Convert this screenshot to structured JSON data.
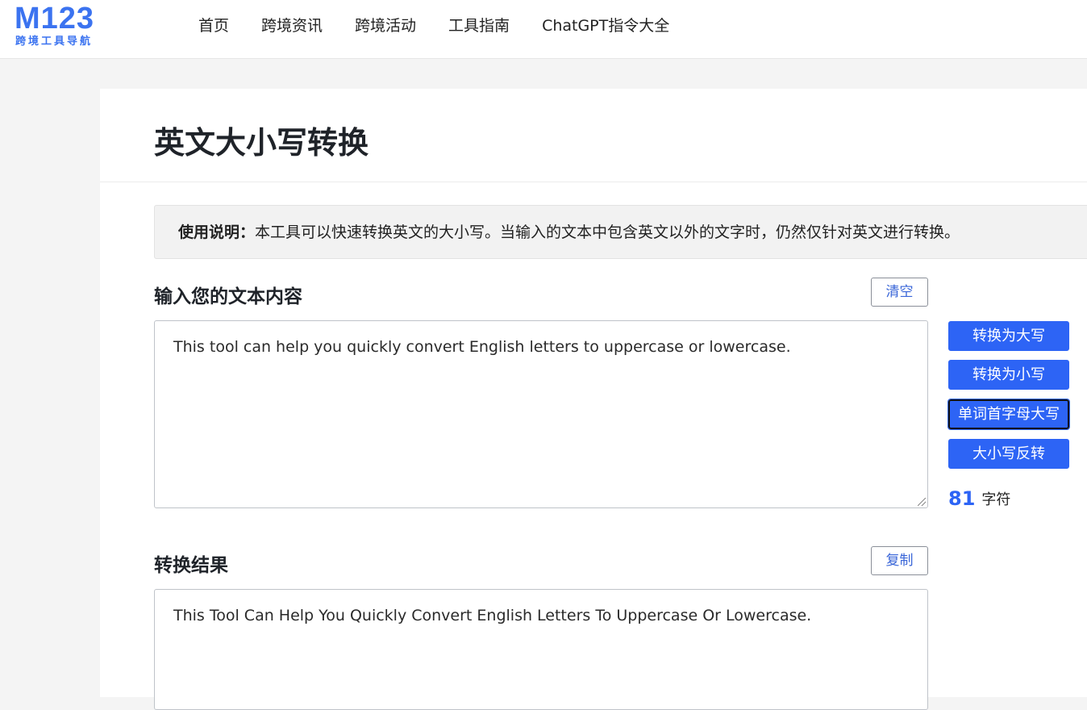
{
  "brand": {
    "logo_mark": "M123",
    "logo_sub": "跨境工具导航",
    "accent": "#2d64f5"
  },
  "nav": {
    "items": [
      {
        "label": "首页"
      },
      {
        "label": "跨境资讯"
      },
      {
        "label": "跨境活动"
      },
      {
        "label": "工具指南"
      },
      {
        "label": "ChatGPT指令大全"
      }
    ]
  },
  "page": {
    "title": "英文大小写转换",
    "notice_label": "使用说明：",
    "notice_text": "本工具可以快速转换英文的大小写。当输入的文本中包含英文以外的文字时，仍然仅针对英文进行转换。"
  },
  "input_section": {
    "label": "输入您的文本内容",
    "clear_button": "清空",
    "value": "This tool can help you quickly convert English letters to uppercase or lowercase."
  },
  "actions": {
    "to_upper": "转换为大写",
    "to_lower": "转换为小写",
    "title_case": "单词首字母大写",
    "invert_case": "大小写反转"
  },
  "counter": {
    "count": "81",
    "unit": "字符"
  },
  "output_section": {
    "label": "转换结果",
    "copy_button": "复制",
    "value": "This Tool Can Help You Quickly Convert English Letters To Uppercase Or Lowercase."
  }
}
